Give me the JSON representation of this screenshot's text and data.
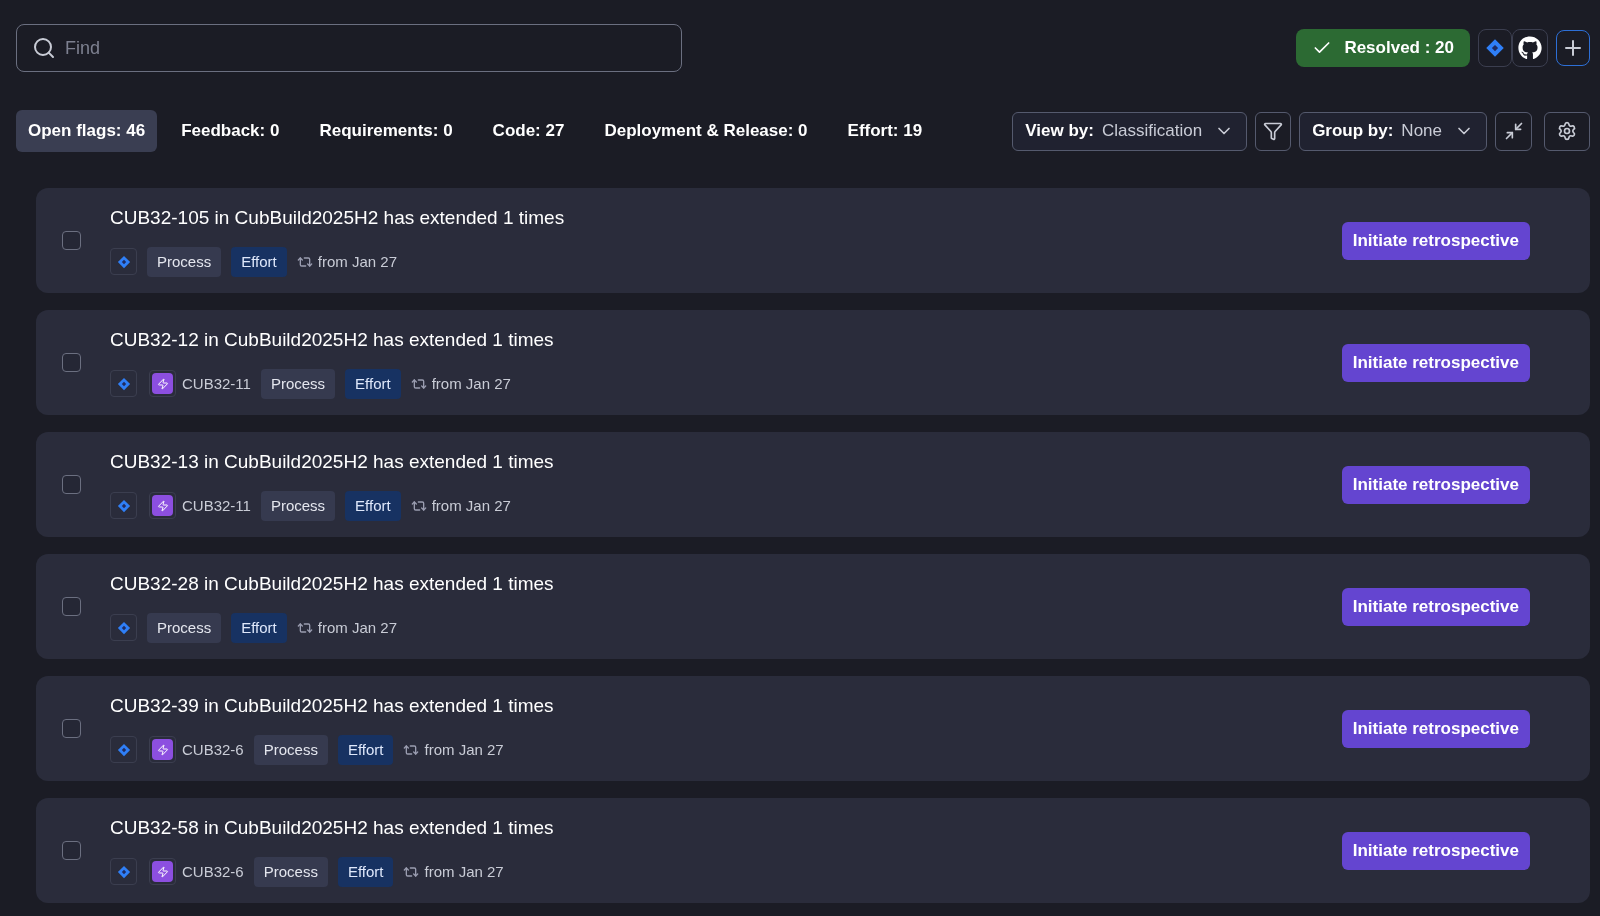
{
  "search": {
    "placeholder": "Find"
  },
  "resolved": {
    "label": "Resolved : 20"
  },
  "tabs": [
    {
      "label": "Open flags: 46",
      "selected": true
    },
    {
      "label": "Feedback: 0",
      "selected": false
    },
    {
      "label": "Requirements: 0",
      "selected": false
    },
    {
      "label": "Code: 27",
      "selected": false
    },
    {
      "label": "Deployment & Release: 0",
      "selected": false
    },
    {
      "label": "Effort: 19",
      "selected": false
    }
  ],
  "view_by": {
    "label": "View by:",
    "value": "Classification"
  },
  "group_by": {
    "label": "Group by:",
    "value": "None"
  },
  "flags": [
    {
      "title": "CUB32-105 in CubBuild2025H2 has extended 1 times",
      "checked": false,
      "tags": [
        {
          "label": "Process",
          "kind": "type"
        },
        {
          "label": "Effort",
          "kind": "category"
        }
      ],
      "since": "from Jan 27",
      "action": "Initiate retrospective"
    },
    {
      "title": "CUB32-12 in CubBuild2025H2 has extended 1 times",
      "checked": false,
      "parent": "CUB32-11",
      "tags": [
        {
          "label": "Process",
          "kind": "type"
        },
        {
          "label": "Effort",
          "kind": "category"
        }
      ],
      "since": "from Jan 27",
      "action": "Initiate retrospective"
    },
    {
      "title": "CUB32-13 in CubBuild2025H2 has extended 1 times",
      "checked": false,
      "parent": "CUB32-11",
      "tags": [
        {
          "label": "Process",
          "kind": "type"
        },
        {
          "label": "Effort",
          "kind": "category"
        }
      ],
      "since": "from Jan 27",
      "action": "Initiate retrospective"
    },
    {
      "title": "CUB32-28 in CubBuild2025H2 has extended 1 times",
      "checked": false,
      "tags": [
        {
          "label": "Process",
          "kind": "type"
        },
        {
          "label": "Effort",
          "kind": "category"
        }
      ],
      "since": "from Jan 27",
      "action": "Initiate retrospective"
    },
    {
      "title": "CUB32-39 in CubBuild2025H2 has extended 1 times",
      "checked": false,
      "parent": "CUB32-6",
      "tags": [
        {
          "label": "Process",
          "kind": "type"
        },
        {
          "label": "Effort",
          "kind": "category"
        }
      ],
      "since": "from Jan 27",
      "action": "Initiate retrospective"
    },
    {
      "title": "CUB32-58 in CubBuild2025H2 has extended 1 times",
      "checked": false,
      "parent": "CUB32-6",
      "tags": [
        {
          "label": "Process",
          "kind": "type"
        },
        {
          "label": "Effort",
          "kind": "category"
        }
      ],
      "since": "from Jan 27",
      "action": "Initiate retrospective"
    }
  ]
}
